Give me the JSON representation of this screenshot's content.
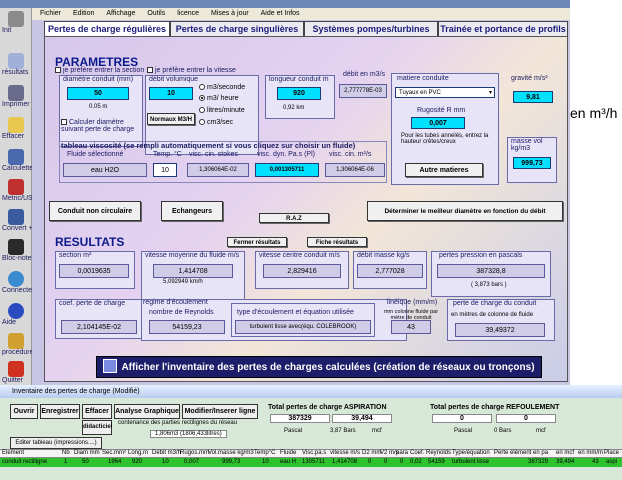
{
  "window": {
    "title": "Inventaire des pertes de charge (Modifié)",
    "menu": [
      "Fichier",
      "Edition",
      "Affichage",
      "Outils",
      "licence",
      "Mises à jour",
      "Aide et Infos"
    ]
  },
  "toolbar": [
    "Init",
    "résultats",
    "Imprimer",
    "Effacer",
    "Calculette",
    "Metric/US",
    "Convert +",
    "Bloc-note",
    "Connecter",
    "Aide",
    "procédure",
    "Quitter"
  ],
  "tabs": [
    "Pertes de charge régulières",
    "Pertes de charge singulières",
    "Systèmes pompes/turbines",
    "Trainée et portance de profils"
  ],
  "overflow_text": "en m³/h",
  "parametres": {
    "title": "PARAMETRES",
    "chk_section": "je préfère entrer la section",
    "chk_vitesse": "je préfère entrer la vitesse",
    "diam_label": "diamètre conduit (mm)",
    "diam_value": "50",
    "diam_sub": "0.05 m",
    "calc_diam": "Calculer diamètre suivant perte de charge",
    "debit_label": "débit volumique",
    "debit_value": "10",
    "debit_btn": "Normaux M3/H",
    "radio_m3s": "m3/seconde",
    "radio_m3h": "m3/ heure",
    "radio_ls": "litres/minute",
    "radio_cm3": "cm3/sec",
    "longueur_label": "longueur conduit m",
    "longueur_value": "920",
    "longueur_sub": "0,92 km",
    "debit_m3s_label": "débit en m3/s",
    "debit_m3s_value": "2,777778E-03",
    "matiere_label": "matiere conduite",
    "matiere_value": "Tuyaux en PVC",
    "rugosite_label": "Rugosité R mm",
    "rugosite_value": "0,007",
    "rugosite_note": "Pour les tubes annelés, entrez la hauteur crêtes/creux",
    "autres_btn": "Autre matieres",
    "gravite_label": "gravité m/s²",
    "gravite_value": "9,81",
    "masse_label": "masse vol kg/m3",
    "masse_value": "999,73",
    "viscosite_title": "tableau viscosité (se rempli automatiquement si vous cliquez sur choisir un fluide)",
    "fluide_label": "Fluide sélectionné",
    "fluide_value": "eau H2O",
    "temp_label": "Temp. °C",
    "temp_value": "10",
    "stokes_label": "visc. cin. stokes",
    "stokes_value": "1,306064E-02",
    "dyn_label": "visc. dyn. Pa.s (Pl)",
    "dyn_value": "0,001305711",
    "cin_label": "visc. cin. m²/s",
    "cin_value": "1,306064E-06"
  },
  "buttons": {
    "non_circulaire": "Conduit non circulaire",
    "echangeurs": "Echangeurs",
    "raz": "R.A.Z",
    "meilleur_diam": "Déterminer le meilleur diamètre en fonction du débit",
    "fermer_res": "Fermer résultats",
    "fiche_res": "Fiche résultats",
    "afficher": "Afficher l'inventaire des pertes de charges calculées (création de réseaux ou tronçons)"
  },
  "resultats": {
    "title": "RESULTATS",
    "section_label": "section m²",
    "section_value": "0,0019635",
    "vmoy_label": "vitesse moyenne du fluide m/s",
    "vmoy_value": "1,414708",
    "vmoy_sub": "5,092949 km/h",
    "vcentre_label": "vitesse centre conduit m/s",
    "vcentre_value": "2,829416",
    "debit_masse_label": "débit masse kg/s",
    "debit_masse_value": "2,777028",
    "pertes_label": "pertes pression en pascals",
    "pertes_value": "387328,8",
    "pertes_sub": "( 3,873 bars )",
    "coef_label": "coef. perte de charge",
    "coef_value": "2,104145E-02",
    "regime_label": "regime d'écoulement",
    "reynolds_label": "nombre de Reynolds",
    "reynolds_value": "54159,23",
    "type_label": "type d'écoulement et équation utilisée",
    "type_value": "turbulent lisse avec(équ. COLEBROOK)",
    "lineique_label": "linéique (mm/m)",
    "lineique_sub": "mm colonne fluide par mètre de conduit",
    "lineique_value": "43",
    "perte_conduit_label": "perte de charge du conduit",
    "perte_conduit_sub": "en mètres de colonne de fluide",
    "perte_conduit_value": "39,49372"
  },
  "inventory": {
    "buttons": [
      "Ouvrir",
      "Enregistrer",
      "Effacer",
      "Analyse Graphique",
      "Modifier/Inserer ligne"
    ],
    "didactitiel": "didacticiel",
    "editer": "Editer tableau (impressions....)",
    "contenance_label": "contenance des parties rectilignes du réseau",
    "contenance_value": "1,806m3 (1806,433litres)",
    "aspiration_title": "Total pertes de charge ASPIRATION",
    "asp_pa": "387329",
    "asp_mcf": "39,494",
    "asp_pa_unit": "Pascal",
    "asp_bars": "3,87 Bars",
    "asp_mcf_unit": "mcf",
    "refoulement_title": "Total pertes de charge REFOULEMENT",
    "ref_pa": "0",
    "ref_mcf": "0",
    "ref_pa_unit": "Pascal",
    "ref_bars": "0 Bars",
    "ref_mcf_unit": "mcf",
    "columns": [
      "Element",
      "Nb",
      "Diam mm",
      "Sec.mm²",
      "Long.m",
      "Débit m3/h",
      "Rugos.mm",
      "Vol.masse kg/m3",
      "Temp°C",
      "Fluide",
      "Visc.pa.s",
      "vitesse m/s",
      "D2 mm",
      "V2 m/s",
      "para",
      "Coef.",
      "Reynolds",
      "Type/équation",
      "Perte élément en pa",
      "en mcf",
      "en mm/m",
      "Place"
    ],
    "row": [
      "conduit rectiligne",
      "1",
      "50",
      "1964",
      "920",
      "10",
      "0,007",
      "999,73",
      "10",
      "eau H",
      "1305711",
      "1,414708",
      "0",
      "0",
      "0",
      "0,02",
      "54159",
      "turbulent lisse",
      "387329",
      "39,494",
      "43",
      "aspi"
    ]
  }
}
